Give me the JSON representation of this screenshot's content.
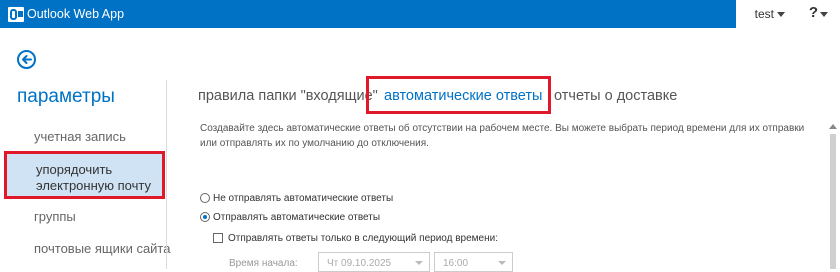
{
  "header": {
    "app_title": "Outlook Web App",
    "user": "test",
    "help": "?",
    "logo_icon": "outlook-logo-icon"
  },
  "sidebar": {
    "back_icon": "back-arrow-icon",
    "title": "параметры",
    "items": [
      {
        "label": "учетная запись",
        "selected": false
      },
      {
        "label": "упорядочить электронную почту",
        "label_line1": "упорядочить",
        "label_line2": "электронную почту",
        "selected": true
      },
      {
        "label": "группы",
        "selected": false
      },
      {
        "label": "почтовые ящики сайта",
        "selected": false
      }
    ]
  },
  "tabs": [
    {
      "label": "правила папки \"входящие\"",
      "active": false
    },
    {
      "label": "автоматические ответы",
      "active": true
    },
    {
      "label": "отчеты о доставке",
      "active": false
    }
  ],
  "main": {
    "description": "Создавайте здесь автоматические ответы об отсутствии на рабочем месте. Вы можете выбрать период времени для их отправки или отправлять их по умолчанию до отключения.",
    "options": [
      {
        "label": "Не отправлять автоматические ответы",
        "checked": false
      },
      {
        "label": "Отправлять автоматические ответы",
        "checked": true
      }
    ],
    "time_period_checkbox": {
      "label": "Отправлять ответы только в следующий период времени:",
      "checked": false
    },
    "start_time": {
      "label": "Время начала:",
      "date": "Чт 09.10.2025",
      "time": "16:00"
    }
  },
  "colors": {
    "accent": "#0072c6",
    "highlight_border": "#e0192a",
    "selected_bg": "#cfe3f4"
  }
}
